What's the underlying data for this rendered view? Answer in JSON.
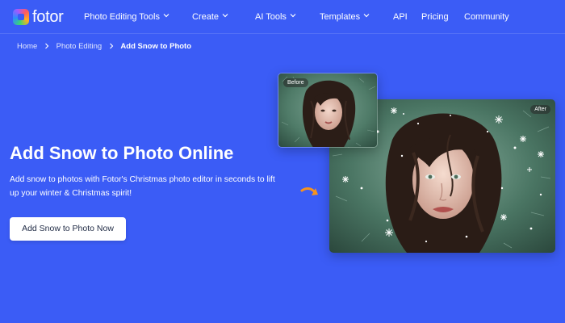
{
  "brand": {
    "name": "fotor"
  },
  "nav": {
    "items": [
      {
        "label": "Photo Editing Tools",
        "has_dropdown": true
      },
      {
        "label": "Create",
        "has_dropdown": true
      },
      {
        "label": "AI Tools",
        "has_dropdown": true
      },
      {
        "label": "Templates",
        "has_dropdown": true
      },
      {
        "label": "API",
        "has_dropdown": false
      },
      {
        "label": "Pricing",
        "has_dropdown": false
      },
      {
        "label": "Community",
        "has_dropdown": false
      }
    ]
  },
  "breadcrumb": {
    "items": [
      "Home",
      "Photo Editing",
      "Add Snow to Photo"
    ]
  },
  "hero": {
    "title": "Add Snow to Photo Online",
    "subtitle": "Add snow to photos with Fotor's Christmas photo editor in seconds to lift up your winter & Christmas spirit!",
    "cta_label": "Add Snow to Photo Now"
  },
  "images": {
    "before_label": "Before",
    "after_label": "After"
  },
  "colors": {
    "background": "#3b5cf6",
    "cta_text": "#1f2a44",
    "arrow": "#f7931e",
    "foliage": "#4a7563"
  },
  "icons": [
    "chevron-down-icon",
    "chevron-right-icon",
    "curved-arrow-icon",
    "snowflake-icon"
  ]
}
